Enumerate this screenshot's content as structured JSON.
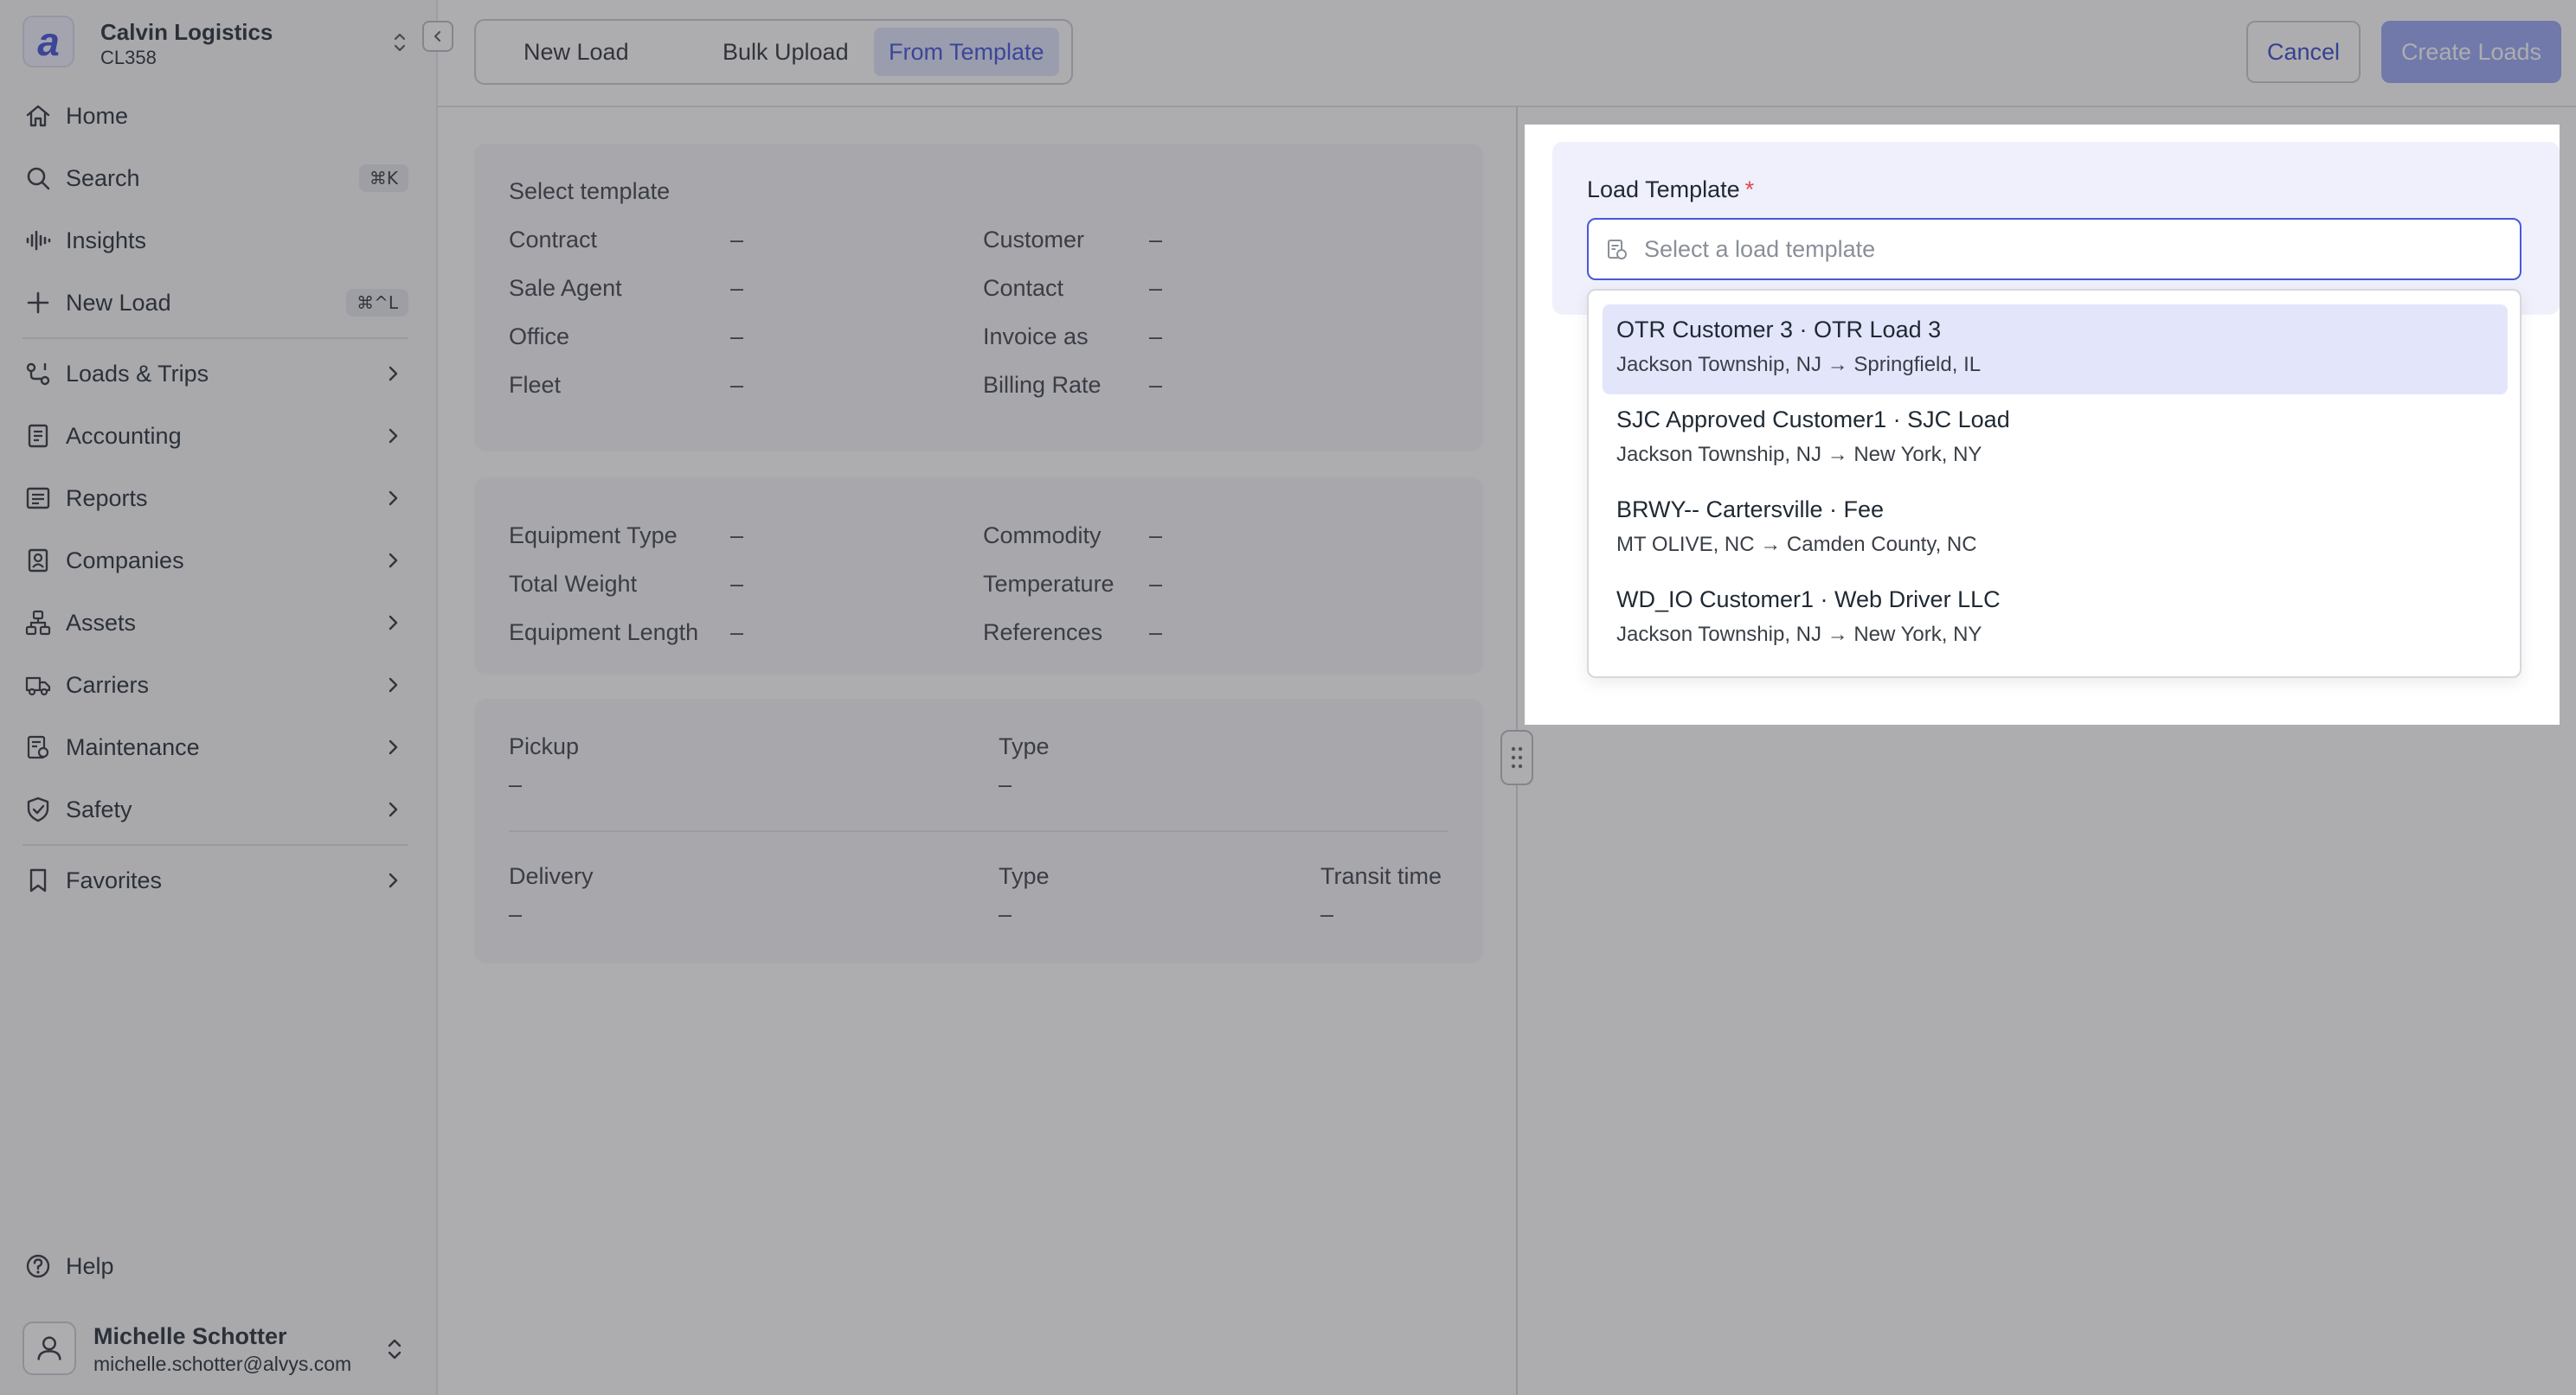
{
  "org": {
    "name": "Calvin Logistics",
    "code": "CL358",
    "logo_letter": "a"
  },
  "nav": {
    "items": [
      {
        "label": "Home",
        "icon": "home-icon"
      },
      {
        "label": "Search",
        "icon": "search-icon",
        "shortcut": "⌘K"
      },
      {
        "label": "Insights",
        "icon": "insights-icon"
      },
      {
        "label": "New Load",
        "icon": "plus-icon",
        "shortcut": "⌘^L"
      },
      {
        "label": "Loads & Trips",
        "icon": "route-icon"
      },
      {
        "label": "Accounting",
        "icon": "ledger-icon"
      },
      {
        "label": "Reports",
        "icon": "report-icon"
      },
      {
        "label": "Companies",
        "icon": "building-icon"
      },
      {
        "label": "Assets",
        "icon": "assets-icon"
      },
      {
        "label": "Carriers",
        "icon": "truck-icon"
      },
      {
        "label": "Maintenance",
        "icon": "maintenance-icon"
      },
      {
        "label": "Safety",
        "icon": "shield-icon"
      },
      {
        "label": "Favorites",
        "icon": "bookmark-icon"
      }
    ],
    "help": "Help"
  },
  "user": {
    "name": "Michelle Schotter",
    "email": "michelle.schotter@alvys.com"
  },
  "tabs": [
    "New Load",
    "Bulk Upload",
    "From Template"
  ],
  "actions": {
    "cancel": "Cancel",
    "create": "Create Loads"
  },
  "summary": {
    "title": "Select template",
    "left": [
      {
        "label": "Contract",
        "value": "–"
      },
      {
        "label": "Sale Agent",
        "value": "–"
      },
      {
        "label": "Office",
        "value": "–"
      },
      {
        "label": "Fleet",
        "value": "–"
      }
    ],
    "right": [
      {
        "label": "Customer",
        "value": "–"
      },
      {
        "label": "Contact",
        "value": "–"
      },
      {
        "label": "Invoice as",
        "value": "–"
      },
      {
        "label": "Billing Rate",
        "value": "–"
      }
    ]
  },
  "equipment": {
    "left": [
      {
        "label": "Equipment Type",
        "value": "–"
      },
      {
        "label": "Total Weight",
        "value": "–"
      },
      {
        "label": "Equipment Length",
        "value": "–"
      }
    ],
    "right": [
      {
        "label": "Commodity",
        "value": "–"
      },
      {
        "label": "Temperature",
        "value": "–"
      },
      {
        "label": "References",
        "value": "–"
      }
    ]
  },
  "stops": {
    "pickup": {
      "label": "Pickup",
      "value": "–",
      "type_label": "Type",
      "type_value": "–"
    },
    "delivery": {
      "label": "Delivery",
      "value": "–",
      "type_label": "Type",
      "type_value": "–",
      "transit_label": "Transit time",
      "transit_value": "–"
    }
  },
  "template_field": {
    "label": "Load Template",
    "required_mark": "*",
    "placeholder": "Select a load template",
    "options": [
      {
        "title": "OTR Customer 3 · OTR Load 3",
        "route": "Jackson Township, NJ → Springfield, IL"
      },
      {
        "title": "SJC Approved Customer1 · SJC Load",
        "route": "Jackson Township, NJ → New York, NY"
      },
      {
        "title": "BRWY-- Cartersville · Fee",
        "route": "MT OLIVE, NC → Camden County, NC"
      },
      {
        "title": "WD_IO Customer1 · Web Driver LLC",
        "route": "Jackson Township, NJ → New York, NY"
      }
    ]
  },
  "colors": {
    "accent": "#3d4fd6",
    "required": "#e0474c",
    "disabled_button": "#97a5f4"
  }
}
